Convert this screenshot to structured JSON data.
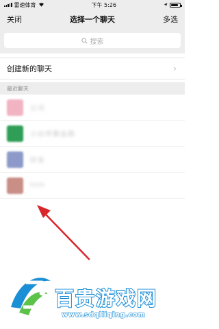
{
  "status_bar": {
    "carrier": "雷速体育",
    "time": "下午 5:26",
    "battery_level": 0.85
  },
  "nav": {
    "close": "关闭",
    "title": "选择一个聊天",
    "multi_select": "多选"
  },
  "search": {
    "placeholder": "搜索",
    "icon": "search-icon"
  },
  "create_chat": {
    "label": "创建新的聊天",
    "chevron": "›"
  },
  "recent_section": {
    "label": "最近聊天"
  },
  "chats": [
    {
      "name_hint": "公司",
      "avatar_color": "#f2b3c2"
    },
    {
      "name_hint": "小伙伴聚会群",
      "avatar_color": "#2f9e57"
    },
    {
      "name_hint": "好友",
      "avatar_color": "#8d9ac9"
    },
    {
      "name_hint": "hhh",
      "avatar_color": "#c98e86"
    }
  ],
  "annotation": {
    "arrow_color": "#d9262b"
  },
  "watermark": {
    "title": "百贵游戏网",
    "url": "www.sdqlliqing.com",
    "logo_colors": [
      "#1a8fd6",
      "#5cc24a"
    ]
  }
}
